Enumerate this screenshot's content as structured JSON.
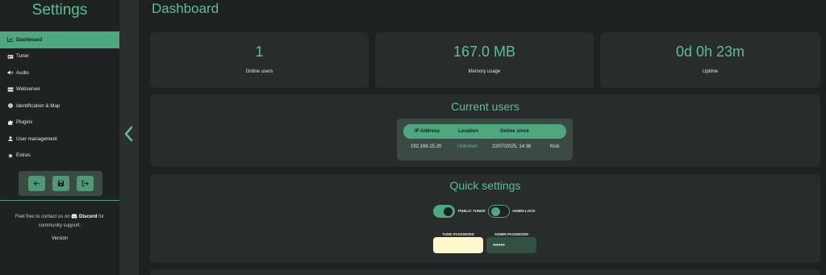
{
  "sidebar": {
    "title": "Settings",
    "items": [
      {
        "label": "Dashboard",
        "icon": "chart-line-icon",
        "active": true
      },
      {
        "label": "Tuner",
        "icon": "radio-icon",
        "active": false
      },
      {
        "label": "Audio",
        "icon": "speaker-icon",
        "active": false
      },
      {
        "label": "Webserver",
        "icon": "server-icon",
        "active": false
      },
      {
        "label": "Identification & Map",
        "icon": "info-circle-icon",
        "active": false
      },
      {
        "label": "Plugins",
        "icon": "puzzle-icon",
        "active": false
      },
      {
        "label": "User management",
        "icon": "user-icon",
        "active": false
      },
      {
        "label": "Extras",
        "icon": "star-icon",
        "active": false
      }
    ],
    "actions": [
      "arrow-left-icon",
      "save-icon",
      "logout-icon"
    ],
    "support": {
      "prefix": "Feel free to contact us on",
      "discord": "Discord",
      "suffix": "for community support."
    },
    "version_label": "Version"
  },
  "main": {
    "title": "Dashboard",
    "stats": [
      {
        "value": "1",
        "label": "Online users"
      },
      {
        "value": "167.0 MB",
        "label": "Memory usage"
      },
      {
        "value": "0d 0h 23m",
        "label": "Uptime"
      }
    ],
    "current_users": {
      "title": "Current users",
      "columns": [
        "IP Address",
        "Location",
        "Online since"
      ],
      "rows": [
        {
          "ip": "192.168.15.20",
          "location": "Unknown",
          "since": "22/07/2025, 14:38",
          "action": "Kick"
        }
      ]
    },
    "quick_settings": {
      "title": "Quick settings",
      "toggles": [
        {
          "label": "PUBLIC TUNER",
          "on": true
        },
        {
          "label": "ADMIN LOCK",
          "on": false
        }
      ],
      "tune_password": {
        "label": "TUNE PASSWORD",
        "value": ""
      },
      "admin_password": {
        "label": "ADMIN PASSWORD",
        "value": "••••••"
      }
    }
  },
  "colors": {
    "accent": "#4ea87f",
    "accent_text": "#5fbf8f",
    "background": "#1e2122",
    "card": "#282c2d"
  }
}
